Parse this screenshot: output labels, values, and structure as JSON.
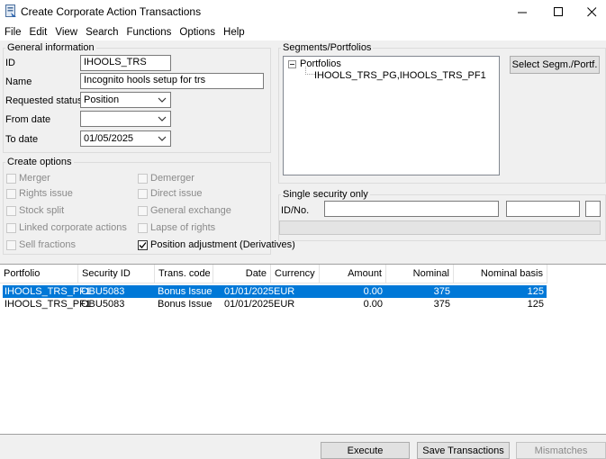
{
  "window": {
    "title": "Create Corporate Action Transactions"
  },
  "menu": [
    "File",
    "Edit",
    "View",
    "Search",
    "Functions",
    "Options",
    "Help"
  ],
  "general": {
    "legend": "General information",
    "id_label": "ID",
    "id_value": "IHOOLS_TRS",
    "name_label": "Name",
    "name_value": "Incognito hools setup for trs",
    "status_label": "Requested status",
    "status_value": "Position",
    "from_label": "From date",
    "from_value": "",
    "to_label": "To date",
    "to_value": "01/05/2025"
  },
  "segments": {
    "legend": "Segments/Portfolios",
    "root": "Portfolios",
    "child": "IHOOLS_TRS_PG,IHOOLS_TRS_PF1",
    "button": "Select Segm./Portf."
  },
  "create_options": {
    "legend": "Create options",
    "items": [
      {
        "label": "Merger",
        "checked": false
      },
      {
        "label": "Demerger",
        "checked": false
      },
      {
        "label": "Rights issue",
        "checked": false
      },
      {
        "label": "Direct issue",
        "checked": false
      },
      {
        "label": "Stock split",
        "checked": false
      },
      {
        "label": "General exchange",
        "checked": false
      },
      {
        "label": "Linked corporate actions",
        "checked": false
      },
      {
        "label": "Lapse of rights",
        "checked": false
      },
      {
        "label": "Sell fractions",
        "checked": false
      },
      {
        "label": "Position adjustment (Derivatives)",
        "checked": true
      }
    ]
  },
  "single_security": {
    "legend": "Single security only",
    "id_label": "ID/No.",
    "id_value": "",
    "field2": "",
    "field3": ""
  },
  "table": {
    "columns": [
      "Portfolio",
      "Security ID",
      "Trans. code",
      "Date",
      "Currency",
      "Amount",
      "Nominal",
      "Nominal basis"
    ],
    "rows": [
      {
        "portfolio": "IHOOLS_TRS_PF1",
        "security": "OBU5083",
        "trans": "Bonus Issue",
        "date": "01/01/2025",
        "currency": "EUR",
        "amount": "0.00",
        "nominal": "375",
        "basis": "125",
        "selected": true
      },
      {
        "portfolio": "IHOOLS_TRS_PF1",
        "security": "OBU5083",
        "trans": "Bonus Issue",
        "date": "01/01/2025",
        "currency": "EUR",
        "amount": "0.00",
        "nominal": "375",
        "basis": "125",
        "selected": false
      }
    ]
  },
  "buttons": {
    "execute": "Execute",
    "save": "Save Transactions",
    "mismatches": "Mismatches"
  },
  "colors": {
    "selection": "#0078d7",
    "window": "#f0f0f0"
  }
}
